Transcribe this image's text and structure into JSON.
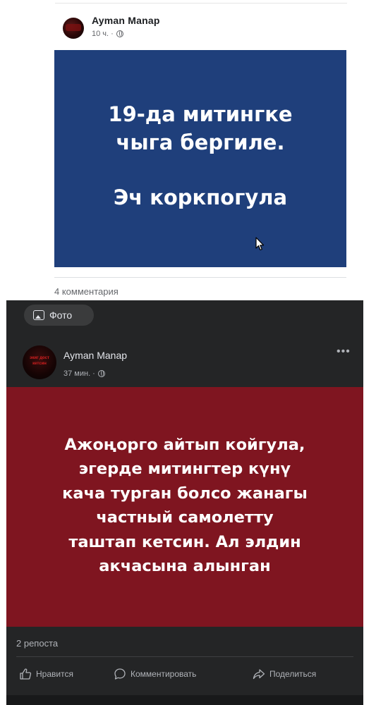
{
  "post1": {
    "author": "Ayman Manap",
    "time": "10 ч. ·",
    "image_text_line1": "19-да митингке\nчыга бергиле.",
    "image_text_line2": "Эч коркпогула",
    "comments": "4 комментария",
    "colors": {
      "image_bg": "#1f3f7b",
      "text": "#ffffff"
    }
  },
  "post2": {
    "photo_tab": "Фото",
    "avatar_text": "экиг дост\nкетсин",
    "author": "Ayman Manap",
    "time": "37 мин. ·",
    "more_icon": "more-horizontal-icon",
    "image_text": "Ажоңорго айтып койгула,\nэгерде митингтер күнү\nкача турган болсо жанагы\nчастный самолетту\nташтап кетсин. Ал элдин\nакчасына алынган",
    "reposts": "2 репоста",
    "actions": {
      "like": "Нравится",
      "comment": "Комментировать",
      "share": "Поделиться"
    },
    "colors": {
      "panel_bg": "#242526",
      "image_bg": "#7f1520",
      "text": "#ffffff",
      "muted": "#b0b3b8"
    }
  }
}
